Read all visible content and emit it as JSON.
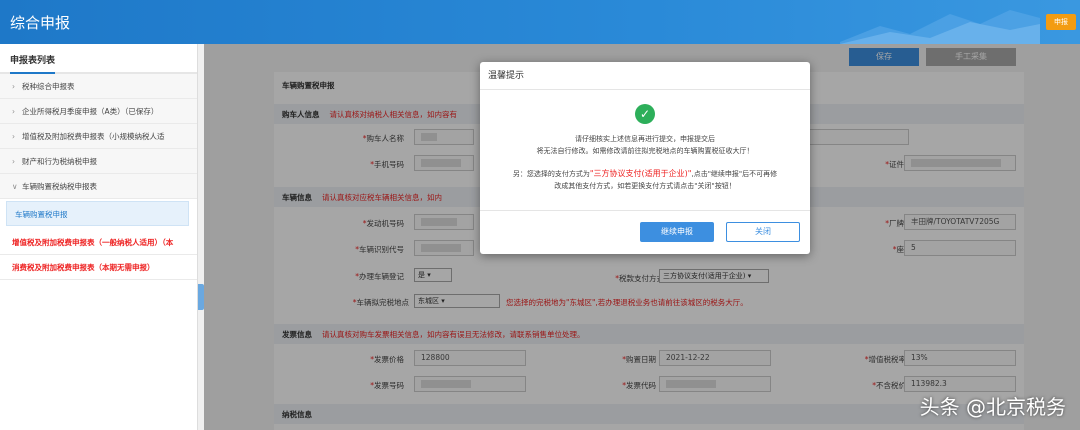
{
  "header": {
    "title": "综合申报",
    "badge": "申报"
  },
  "sidebar": {
    "title": "申报表列表",
    "items": [
      {
        "label": "税种综合申报表",
        "chev": "›"
      },
      {
        "label": "企业所得税月季度申报（A类）（已保存）",
        "chev": "›"
      },
      {
        "label": "增值税及附加税费申报表（小规模纳税人适",
        "chev": "›"
      },
      {
        "label": "财产和行为税纳税申报",
        "chev": "›"
      },
      {
        "label": "车辆购置税纳税申报表",
        "chev": "∨"
      }
    ],
    "active": "车辆购置税申报",
    "red_items": [
      "增值税及附加税费申报表（一般纳税人适用）（本",
      "消费税及附加税费申报表（本期无需申报）"
    ]
  },
  "toolbar": {
    "save": "保存",
    "manual": "手工采集"
  },
  "form": {
    "title": "车辆购置税申报",
    "buyer_section": "购车人信息",
    "buyer_hint": "请认真核对纳税人相关信息，如内容有",
    "buyer_name_label": "购车人名称",
    "phone_label": "手机号码",
    "id_label": "证件号码",
    "vehicle_section": "车辆信息",
    "vehicle_hint": "请认真核对应税车辆相关信息，如内",
    "engine_label": "发动机号码",
    "model_label": "厂牌型号",
    "model_value": "丰田牌/TOYOTATV7205G",
    "vin_label": "车辆识别代号",
    "seats_label": "座位数",
    "seats_value": "5",
    "register_label": "办理车辆登记",
    "register_value": "是",
    "pay_label": "税款支付方式",
    "pay_value": "三方协议支付(适用于企业)",
    "office_label": "车辆拟完税地点",
    "office_value": "东城区",
    "office_note": "您选择的完税地为\"东城区\",若办理退税业务也请前往该城区的税务大厅。",
    "invoice_section": "发票信息",
    "invoice_hint": "请认真核对购车发票相关信息，如内容有误且无法修改，请联系销售单位处理。",
    "price_label": "发票价格",
    "price_value": "128800",
    "date_label": "购置日期",
    "date_value": "2021-12-22",
    "vat_label": "增值税税率",
    "vat_value": "13%",
    "invno_label": "发票号码",
    "invcode_label": "发票代码",
    "nontax_label": "不含税价",
    "nontax_value": "113982.3",
    "tax_section": "纳税信息"
  },
  "modal": {
    "title": "温馨提示",
    "line1": "请仔细核实上述信息再进行提交，申报提交后",
    "line2": "将无法自行修改。如需修改请前往拟完税地点的车辆购置税征收大厅！",
    "line3_pre": "另：您选择的支付方式为",
    "line3_hl": "\"三方协议支付(适用于企业)\"",
    "line3_post": ",点击\"继续申报\"后不可再修",
    "line4": "改成其他支付方式，如若更换支付方式请点击\"关闭\"按钮！",
    "continue": "继续申报",
    "close": "关闭"
  },
  "watermark": "头条 @北京税务",
  "colors": {
    "brand": "#1e78c8",
    "success": "#2daf5a",
    "warning": "#e22222"
  }
}
